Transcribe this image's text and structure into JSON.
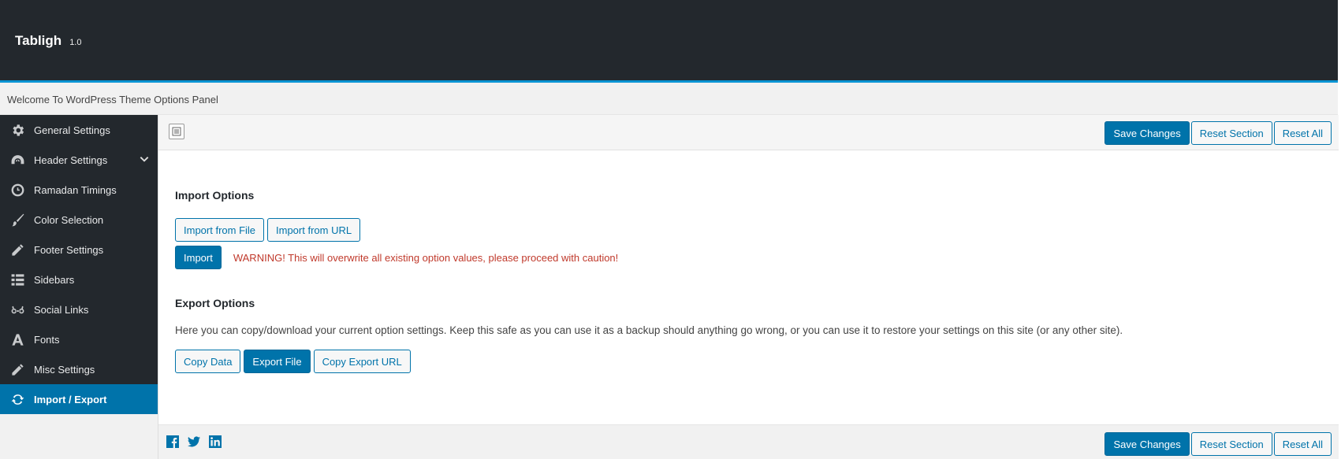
{
  "brand": {
    "name": "Tabligh",
    "version": "1.0"
  },
  "subheader": {
    "text": "Welcome To WordPress Theme Options Panel"
  },
  "sidebar": {
    "items": [
      {
        "label": "General Settings",
        "icon": "gear-icon"
      },
      {
        "label": "Header Settings",
        "icon": "dashboard-icon",
        "has_submenu": true
      },
      {
        "label": "Ramadan Timings",
        "icon": "clock-icon"
      },
      {
        "label": "Color Selection",
        "icon": "brush-icon"
      },
      {
        "label": "Footer Settings",
        "icon": "pencil-icon"
      },
      {
        "label": "Sidebars",
        "icon": "list-icon"
      },
      {
        "label": "Social Links",
        "icon": "glasses-icon"
      },
      {
        "label": "Fonts",
        "icon": "font-icon"
      },
      {
        "label": "Misc Settings",
        "icon": "pencil-icon"
      },
      {
        "label": "Import / Export",
        "icon": "refresh-icon",
        "active": true
      }
    ]
  },
  "toolbar": {
    "save_label": "Save Changes",
    "reset_section_label": "Reset Section",
    "reset_all_label": "Reset All"
  },
  "import": {
    "title": "Import Options",
    "from_file_label": "Import from File",
    "from_url_label": "Import from URL",
    "import_label": "Import",
    "warning": "WARNING! This will overwrite all existing option values, please proceed with caution!"
  },
  "export": {
    "title": "Export Options",
    "description": "Here you can copy/download your current option settings. Keep this safe as you can use it as a backup should anything go wrong, or you can use it to restore your settings on this site (or any other site).",
    "copy_data_label": "Copy Data",
    "export_file_label": "Export File",
    "copy_url_label": "Copy Export URL"
  },
  "footer": {
    "social": [
      "facebook-icon",
      "twitter-icon",
      "linkedin-icon"
    ],
    "save_label": "Save Changes",
    "reset_section_label": "Reset Section",
    "reset_all_label": "Reset All"
  },
  "colors": {
    "header_bg": "#23282d",
    "accent": "#0073aa",
    "header_border": "#0b95d4",
    "warning": "#c0392b"
  }
}
